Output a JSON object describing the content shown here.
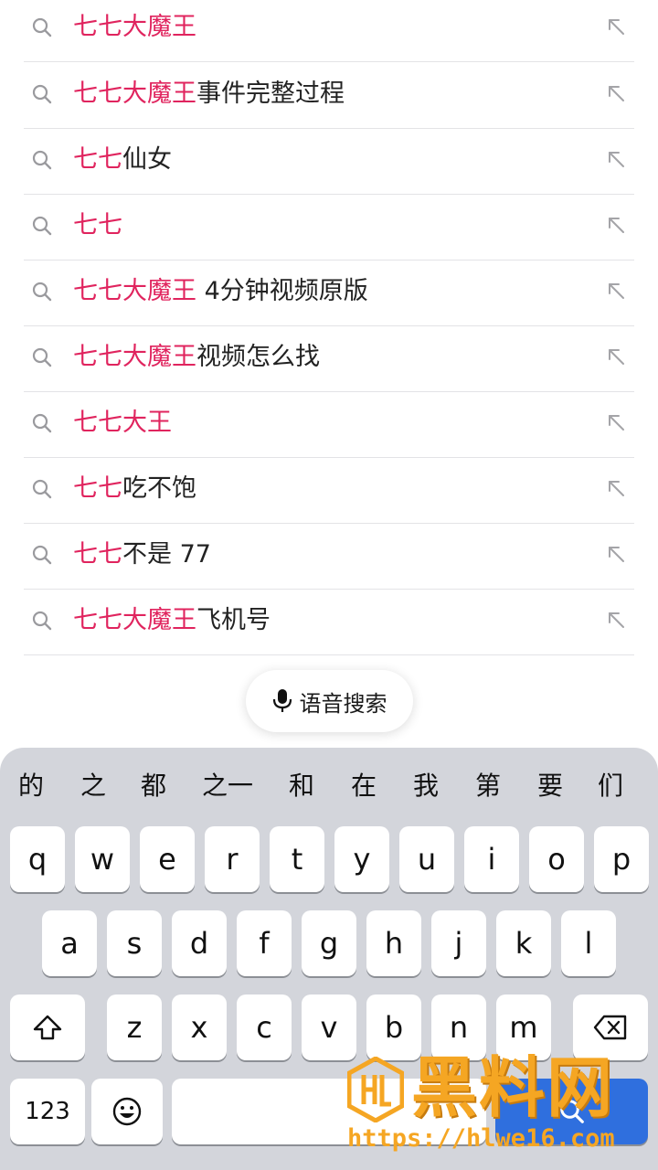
{
  "suggestions": [
    {
      "highlight": "七七大魔王",
      "rest": ""
    },
    {
      "highlight": "七七大魔王",
      "rest": "事件完整过程"
    },
    {
      "highlight": "七七",
      "rest": "仙女"
    },
    {
      "highlight": "七七",
      "rest": ""
    },
    {
      "highlight": "七七大魔王",
      "rest": " 4分钟视频原版"
    },
    {
      "highlight": "七七大魔王",
      "rest": "视频怎么找"
    },
    {
      "highlight": "七七大王",
      "rest": ""
    },
    {
      "highlight": "七七",
      "rest": "吃不饱"
    },
    {
      "highlight": "七七",
      "rest": "不是 77"
    },
    {
      "highlight": "七七大魔王",
      "rest": "飞机号"
    }
  ],
  "voice_search": {
    "label": "语音搜索"
  },
  "keyboard": {
    "candidates": [
      "的",
      "之",
      "都",
      "之一",
      "和",
      "在",
      "我",
      "第",
      "要",
      "们"
    ],
    "row1": [
      "q",
      "w",
      "e",
      "r",
      "t",
      "y",
      "u",
      "i",
      "o",
      "p"
    ],
    "row2": [
      "a",
      "s",
      "d",
      "f",
      "g",
      "h",
      "j",
      "k",
      "l"
    ],
    "row3": [
      "z",
      "x",
      "c",
      "v",
      "b",
      "n",
      "m"
    ],
    "numbers_key": "123"
  },
  "watermark": {
    "title": "黑料网",
    "url": "https://hlwe16.com"
  },
  "colors": {
    "highlight": "#e0245e",
    "keyboard_bg": "#d3d5db",
    "search_key": "#2f6fde"
  }
}
